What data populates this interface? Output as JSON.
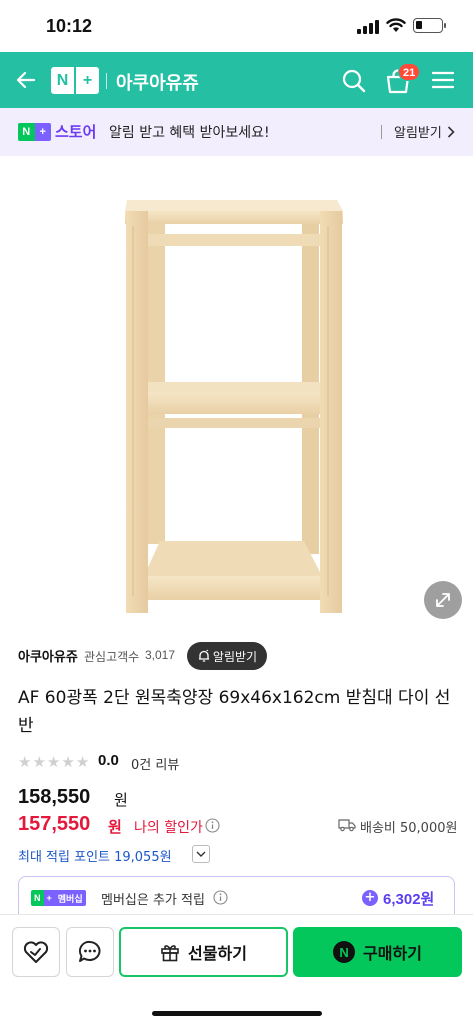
{
  "status_bar": {
    "time": "10:12"
  },
  "header": {
    "logo_left": "N",
    "logo_right": "+",
    "store_name": "아쿠아유쥬",
    "cart_count": "21",
    "icons": [
      "back-arrow-icon",
      "search-icon",
      "cart-icon",
      "menu-icon"
    ],
    "accent_color": "#25c0a4"
  },
  "banner": {
    "np_left": "N",
    "np_right": "+",
    "store_label": "스토어",
    "message": "알림 받고 혜택 받아보세요!",
    "subscribe_label": "알림받기"
  },
  "seller": {
    "name": "아쿠아유쥬",
    "fans_label": "관심고객수",
    "fans_count": "3,017",
    "alarm_label": "알림받기"
  },
  "product": {
    "name": "AF 60광폭 2단 원목축양장 69x46x162cm 받침대 다이 선반",
    "rating": "0.0",
    "review_count": "0건 리뷰",
    "original_price": "158,550",
    "original_unit": "원",
    "sale_price": "157,550",
    "sale_unit": "원",
    "my_sale_label": "나의 할인가",
    "shipping": "배송비 50,000원",
    "max_points": "최대 적립 포인트 19,055원"
  },
  "membership": {
    "badge_n": "N",
    "badge_plus": "+",
    "badge_label": "멤버십",
    "text": "멤버십은 추가 적립",
    "points": "6,302원",
    "plus_sign": "+"
  },
  "actions": {
    "gift_label": "선물하기",
    "buy_label": "구매하기",
    "buy_badge": "N",
    "brand_green": "#03c75a"
  }
}
